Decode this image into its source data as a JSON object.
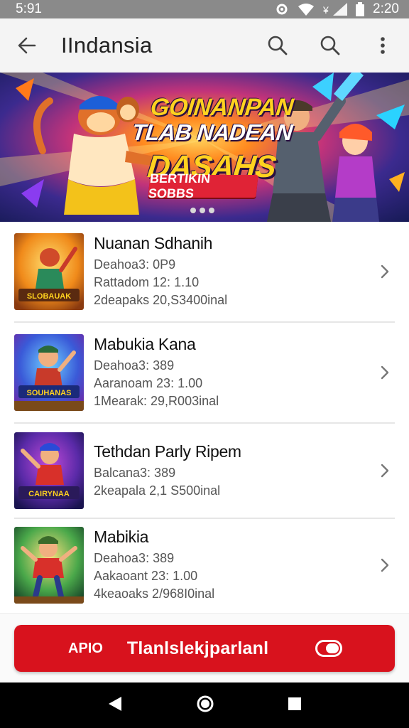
{
  "status": {
    "time": "5:91",
    "clock": "2:20",
    "icons": [
      "settings-icon",
      "wifi-icon",
      "signal-icon",
      "battery-icon"
    ]
  },
  "appbar": {
    "title": "IIndansia",
    "icons": [
      "back-arrow-icon",
      "search-icon",
      "search-icon",
      "more-vert-icon"
    ]
  },
  "banner": {
    "line1": "GOINANPAN",
    "line2": "TLAB NADEAN",
    "line3": "DASAHS",
    "tag": "BERTIKIN SOBBS",
    "dots": 3
  },
  "games": [
    {
      "name": "Nuanan Sdhanih",
      "line1": "Deahoa3: 0P9",
      "line2": "Rattadom 12: 1.10",
      "line3": "2deapaks 20,S3400inal",
      "thumb_text": "SLOBAUAK"
    },
    {
      "name": "Mabukia Kana",
      "line1": "Deahoa3: 389",
      "line2": "Aaranoam 23: 1.00",
      "line3": "1Mearak: 29,R003inal",
      "thumb_text": "SOUHANAS"
    },
    {
      "name": "Tethdan Parly Ripem",
      "line1": "Balcana3: 389",
      "line2": "2keapala 2,1 S500inal",
      "line3": "",
      "thumb_text": "CAIRYNAA"
    },
    {
      "name": "Mabikia",
      "line1": "Deahoa3: 389",
      "line2": "Aakaoant 23: 1.00",
      "line3": "4keaoaks 2/968I0inal",
      "thumb_text": ""
    }
  ],
  "cta": {
    "left_label": "APIO",
    "label": "Tlanlslekjparlanl"
  },
  "colors": {
    "accent": "#d8121d",
    "status_bar": "#8a8a8a",
    "app_bar": "#f4f4f4"
  }
}
